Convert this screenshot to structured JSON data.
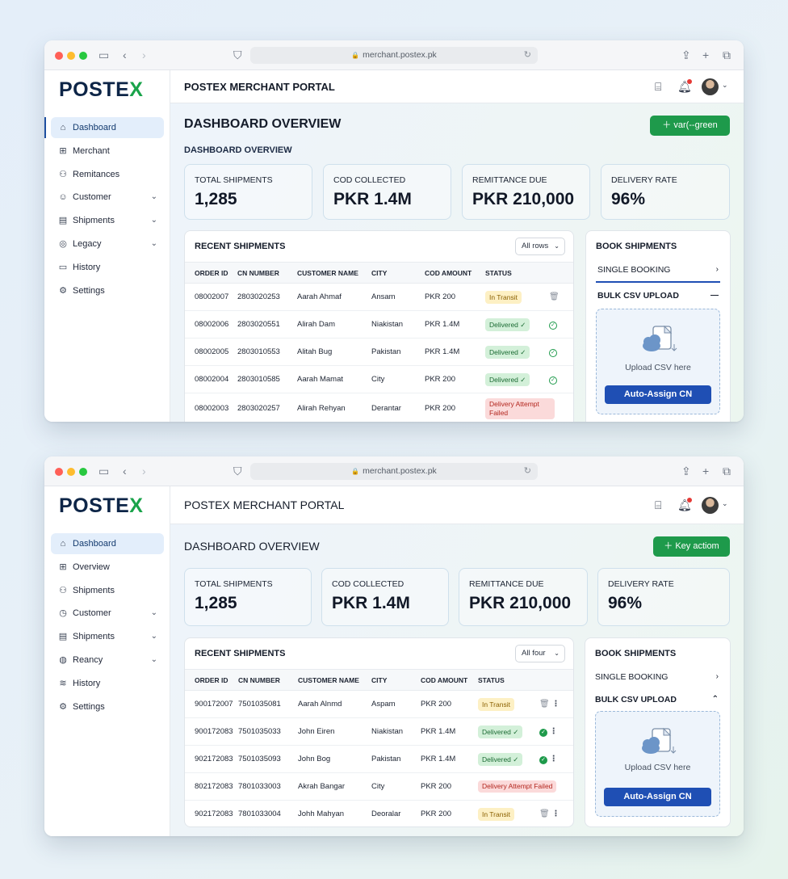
{
  "browser": {
    "url": "merchant.postex.pk"
  },
  "logo": {
    "main": "POSTE",
    "accent": "X"
  },
  "colors": {
    "brand_navy": "#0d2547",
    "brand_green": "#19a34a",
    "action_green": "#1e9a4b",
    "upload_blue": "#1f4fb4"
  },
  "windows": [
    {
      "header_title": "POSTEX MERCHANT PORTAL",
      "nav": [
        {
          "label": "Dashboard",
          "icon": "home-icon",
          "active": true
        },
        {
          "label": "Merchant",
          "icon": "grid-icon"
        },
        {
          "label": "Remitances",
          "icon": "users-icon"
        },
        {
          "label": "Customer",
          "icon": "customer-icon",
          "expandable": true
        },
        {
          "label": "Shipments",
          "icon": "document-icon",
          "expandable": true
        },
        {
          "label": "Legacy",
          "icon": "check-circle-icon",
          "expandable": true
        },
        {
          "label": "History",
          "icon": "wallet-icon"
        },
        {
          "label": "Settings",
          "icon": "gear-icon"
        }
      ],
      "page_title": "DASHBOARD OVERVIEW",
      "page_subtitle": "DASHBOARD OVERVIEW",
      "action_button": "var(--green",
      "kpis": [
        {
          "label": "TOTAL SHIPMENTS",
          "value": "1,285"
        },
        {
          "label": "COD COLLECTED",
          "value": "PKR 1.4M"
        },
        {
          "label": "REMITTANCE DUE",
          "value": "PKR 210,000"
        },
        {
          "label": "DELIVERY RATE",
          "value": "96%"
        }
      ],
      "recent": {
        "title": "RECENT SHIPMENTS",
        "filter": "All rows",
        "columns": [
          "ORDER ID",
          "CN NUMBER",
          "CUSTOMER NAME",
          "CITY",
          "COD AMOUNT",
          "STATUS"
        ],
        "rows": [
          {
            "order": "08002007",
            "cn": "2803020253",
            "customer": "Aarah Ahmaf",
            "city": "Ansam",
            "cod": "PKR 200",
            "status": "In Transit",
            "kind": "transit"
          },
          {
            "order": "08002006",
            "cn": "2803020551",
            "customer": "Alirah Dam",
            "city": "Niakistan",
            "cod": "PKR 1.4M",
            "status": "Delivered",
            "kind": "delivered"
          },
          {
            "order": "08002005",
            "cn": "2803010553",
            "customer": "Alitah Bug",
            "city": "Pakistan",
            "cod": "PKR 1.4M",
            "status": "Delivered",
            "kind": "delivered"
          },
          {
            "order": "08002004",
            "cn": "2803010585",
            "customer": "Aarah Mamat",
            "city": "City",
            "cod": "PKR 200",
            "status": "Delivered",
            "kind": "delivered"
          },
          {
            "order": "08002003",
            "cn": "2803020257",
            "customer": "Alirah Rehyan",
            "city": "Derantar",
            "cod": "PKR 200",
            "status": "Delivery Attempt Failed",
            "kind": "failed"
          }
        ]
      },
      "book": {
        "title": "BOOK SHIPMENTS",
        "single": "SINGLE BOOKING",
        "bulk": "BULK CSV UPLOAD",
        "upload_label": "Upload CSV here",
        "assign_button": "Auto-Assign CN"
      }
    },
    {
      "header_title": "POSTEX MERCHANT PORTAL",
      "nav": [
        {
          "label": "Dashboard",
          "icon": "home-icon",
          "active": true
        },
        {
          "label": "Overview",
          "icon": "grid-icon"
        },
        {
          "label": "Shipments",
          "icon": "users-icon"
        },
        {
          "label": "Customer",
          "icon": "clock-icon",
          "expandable": true
        },
        {
          "label": "Shipments",
          "icon": "document-icon",
          "expandable": true
        },
        {
          "label": "Reancy",
          "icon": "support-icon",
          "expandable": true
        },
        {
          "label": "History",
          "icon": "layers-icon"
        },
        {
          "label": "Settings",
          "icon": "gear-icon"
        }
      ],
      "page_title": "DASHBOARD OVERVIEW",
      "action_button": "Key actiom",
      "kpis": [
        {
          "label": "TOTAL SHIPMENTS",
          "value": "1,285"
        },
        {
          "label": "COD COLLECTED",
          "value": "PKR 1.4M"
        },
        {
          "label": "REMITTANCE DUE",
          "value": "PKR 210,000"
        },
        {
          "label": "DELIVERY RATE",
          "value": "96%"
        }
      ],
      "recent": {
        "title": "RECENT SHIPMENTS",
        "filter": "All four",
        "columns": [
          "ORDER ID",
          "CN NUMBER",
          "CUSTOMER NAME",
          "CITY",
          "COD AMOUNT",
          "STATUS"
        ],
        "rows": [
          {
            "order": "900172007",
            "cn": "7501035081",
            "customer": "Aarah Alnmd",
            "city": "Aspam",
            "cod": "PKR 200",
            "status": "In Transit",
            "kind": "transit"
          },
          {
            "order": "900172083",
            "cn": "7501035033",
            "customer": "John Eiren",
            "city": "Niakistan",
            "cod": "PKR 1.4M",
            "status": "Delivered",
            "kind": "delivered"
          },
          {
            "order": "902172083",
            "cn": "7501035093",
            "customer": "John Bog",
            "city": "Pakistan",
            "cod": "PKR 1.4M",
            "status": "Delivered",
            "kind": "delivered"
          },
          {
            "order": "802172083",
            "cn": "7801033003",
            "customer": "Akrah Bangar",
            "city": "City",
            "cod": "PKR 200",
            "status": "Delivery Attempt Failed",
            "kind": "failed"
          },
          {
            "order": "902172083",
            "cn": "7801033004",
            "customer": "Johh Mahyan",
            "city": "Deoralar",
            "cod": "PKR 200",
            "status": "In Transit",
            "kind": "transit"
          }
        ]
      },
      "book": {
        "title": "BOOK SHIPMENTS",
        "single": "SINGLE BOOKING",
        "bulk": "BULK CSV UPLOAD",
        "upload_label": "Upload CSV here",
        "assign_button": "Auto-Assign CN"
      }
    }
  ]
}
